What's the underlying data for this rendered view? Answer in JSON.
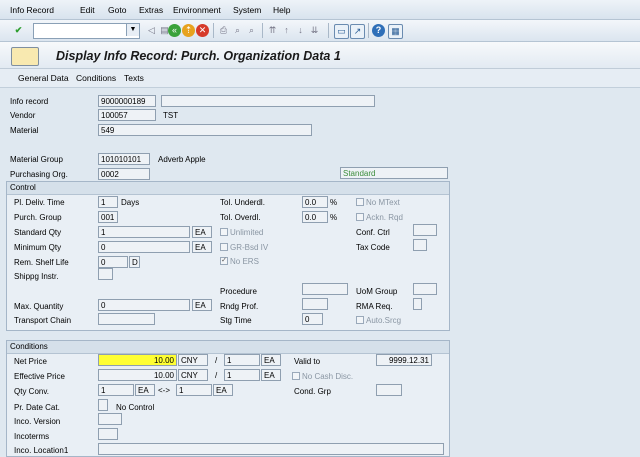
{
  "menu": [
    "Info Record",
    "Edit",
    "Goto",
    "Extras",
    "Environment",
    "System",
    "Help"
  ],
  "page_title": "Display Info Record: Purch. Organization Data 1",
  "tabs": [
    "General Data",
    "Conditions",
    "Texts"
  ],
  "header": {
    "info_record_label": "Info record",
    "info_record": "9000000189",
    "vendor_label": "Vendor",
    "vendor": "100057",
    "vendor_name": "TST",
    "material_label": "Material",
    "material": "549",
    "material_group_label": "Material Group",
    "material_group": "101010101",
    "material_group_text": "Adverb Apple",
    "purch_org_label": "Purchasing Org.",
    "purch_org": "0002",
    "standard": "Standard"
  },
  "control": {
    "title": "Control",
    "pl_deliv_time_label": "Pl. Deliv. Time",
    "pl_deliv_time": "1",
    "days": "Days",
    "purch_group_label": "Purch. Group",
    "purch_group": "001",
    "standard_qty_label": "Standard Qty",
    "standard_qty": "1",
    "standard_qty_unit": "EA",
    "minimum_qty_label": "Minimum Qty",
    "minimum_qty": "0",
    "minimum_qty_unit": "EA",
    "rem_shelf_life_label": "Rem. Shelf Life",
    "rem_shelf_life": "0",
    "rem_shelf_life_unit": "D",
    "shippg_instr_label": "Shippg Instr.",
    "max_quantity_label": "Max. Quantity",
    "max_quantity": "0",
    "max_quantity_unit": "EA",
    "transport_chain_label": "Transport Chain",
    "tol_underdl_label": "Tol. Underdl.",
    "tol_underdl": "0.0",
    "tol_underdl_unit": "%",
    "tol_overdl_label": "Tol. Overdl.",
    "tol_overdl": "0.0",
    "tol_overdl_unit": "%",
    "unlimited_label": "Unlimited",
    "gr_bsd_iv_label": "GR-Bsd IV",
    "no_ers_label": "No ERS",
    "procedure_label": "Procedure",
    "rndg_prof_label": "Rndg Prof.",
    "stg_time_label": "Stg Time",
    "stg_time": "0",
    "no_mtext_label": "No MText",
    "ackn_rqd_label": "Ackn. Rqd",
    "conf_ctrl_label": "Conf. Ctrl",
    "tax_code_label": "Tax Code",
    "uom_group_label": "UoM Group",
    "rma_req_label": "RMA Req.",
    "auto_srcg_label": "Auto.Srcg"
  },
  "conditions": {
    "title": "Conditions",
    "net_price_label": "Net Price",
    "net_price": "10.00",
    "net_price_curr": "CNY",
    "net_per": "1",
    "net_unit": "EA",
    "eff_price_label": "Effective Price",
    "eff_price": "10.00",
    "eff_price_curr": "CNY",
    "eff_per": "1",
    "eff_unit": "EA",
    "slash": "/",
    "qty_conv_label": "Qty Conv.",
    "qty_conv_1": "1",
    "qty_conv_1_unit": "EA",
    "arrow": "<->",
    "qty_conv_2": "1",
    "qty_conv_2_unit": "EA",
    "pr_date_cat_label": "Pr. Date Cat.",
    "pr_date_cat_text": "No Control",
    "inco_version_label": "Inco. Version",
    "incoterms_label": "Incoterms",
    "inco_location1_label": "Inco. Location1",
    "valid_to_label": "Valid to",
    "valid_to": "9999.12.31",
    "no_cash_disc_label": "No Cash Disc.",
    "cond_grp_label": "Cond. Grp"
  }
}
